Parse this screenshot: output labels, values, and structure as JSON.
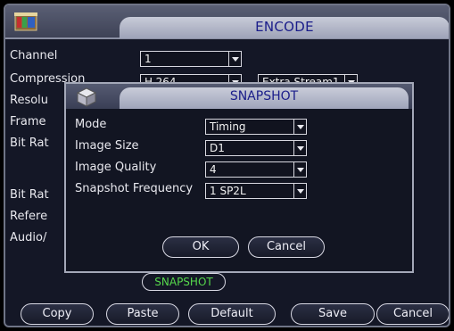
{
  "window": {
    "title": "ENCODE"
  },
  "encode": {
    "labels": [
      "Channel",
      "Compression",
      "Resolu",
      "Frame",
      "Bit Rat",
      "Bit Rat",
      "Refere",
      "Audio/"
    ],
    "channel_value": "1",
    "compression_value": "H.264",
    "stream_value": "Extra Stream1",
    "snapshot_tag": "SNAPSHOT"
  },
  "dialog": {
    "title": "SNAPSHOT",
    "rows": [
      {
        "label": "Mode",
        "value": "Timing"
      },
      {
        "label": "Image Size",
        "value": "D1"
      },
      {
        "label": "Image Quality",
        "value": "4"
      },
      {
        "label": "Snapshot Frequency",
        "value": "1 SP2L"
      }
    ],
    "ok_label": "OK",
    "cancel_label": "Cancel"
  },
  "bottom_buttons": {
    "copy": "Copy",
    "paste": "Paste",
    "default": "Default",
    "save": "Save",
    "cancel": "Cancel"
  },
  "colors": {
    "title_text": "#1a1d8a",
    "snapshot_tag_text": "#56d84c",
    "background": "#141726"
  }
}
